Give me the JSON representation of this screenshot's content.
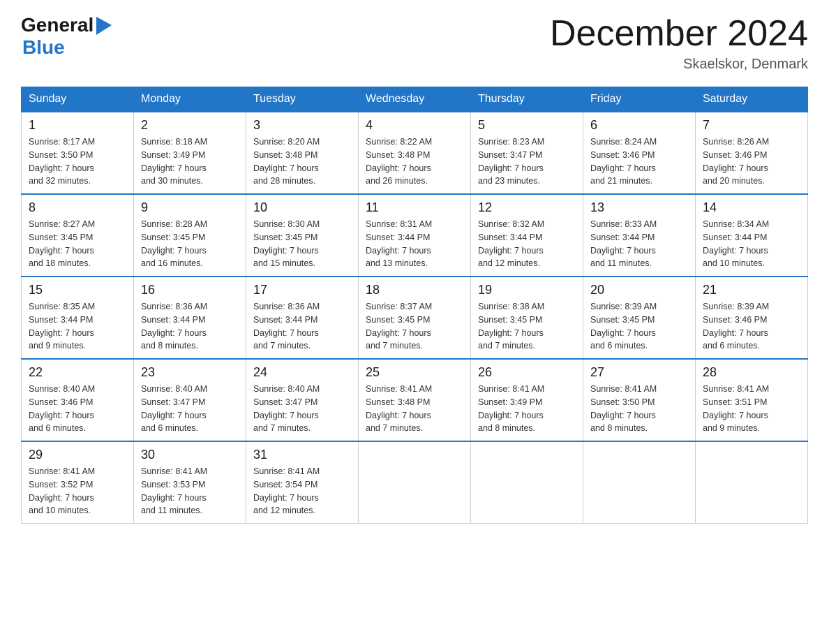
{
  "header": {
    "logo": {
      "general": "General",
      "blue": "Blue",
      "line2": "Blue"
    },
    "title": "December 2024",
    "location": "Skaelskor, Denmark"
  },
  "days_of_week": [
    "Sunday",
    "Monday",
    "Tuesday",
    "Wednesday",
    "Thursday",
    "Friday",
    "Saturday"
  ],
  "weeks": [
    [
      {
        "day": "1",
        "sunrise": "8:17 AM",
        "sunset": "3:50 PM",
        "daylight": "7 hours and 32 minutes."
      },
      {
        "day": "2",
        "sunrise": "8:18 AM",
        "sunset": "3:49 PM",
        "daylight": "7 hours and 30 minutes."
      },
      {
        "day": "3",
        "sunrise": "8:20 AM",
        "sunset": "3:48 PM",
        "daylight": "7 hours and 28 minutes."
      },
      {
        "day": "4",
        "sunrise": "8:22 AM",
        "sunset": "3:48 PM",
        "daylight": "7 hours and 26 minutes."
      },
      {
        "day": "5",
        "sunrise": "8:23 AM",
        "sunset": "3:47 PM",
        "daylight": "7 hours and 23 minutes."
      },
      {
        "day": "6",
        "sunrise": "8:24 AM",
        "sunset": "3:46 PM",
        "daylight": "7 hours and 21 minutes."
      },
      {
        "day": "7",
        "sunrise": "8:26 AM",
        "sunset": "3:46 PM",
        "daylight": "7 hours and 20 minutes."
      }
    ],
    [
      {
        "day": "8",
        "sunrise": "8:27 AM",
        "sunset": "3:45 PM",
        "daylight": "7 hours and 18 minutes."
      },
      {
        "day": "9",
        "sunrise": "8:28 AM",
        "sunset": "3:45 PM",
        "daylight": "7 hours and 16 minutes."
      },
      {
        "day": "10",
        "sunrise": "8:30 AM",
        "sunset": "3:45 PM",
        "daylight": "7 hours and 15 minutes."
      },
      {
        "day": "11",
        "sunrise": "8:31 AM",
        "sunset": "3:44 PM",
        "daylight": "7 hours and 13 minutes."
      },
      {
        "day": "12",
        "sunrise": "8:32 AM",
        "sunset": "3:44 PM",
        "daylight": "7 hours and 12 minutes."
      },
      {
        "day": "13",
        "sunrise": "8:33 AM",
        "sunset": "3:44 PM",
        "daylight": "7 hours and 11 minutes."
      },
      {
        "day": "14",
        "sunrise": "8:34 AM",
        "sunset": "3:44 PM",
        "daylight": "7 hours and 10 minutes."
      }
    ],
    [
      {
        "day": "15",
        "sunrise": "8:35 AM",
        "sunset": "3:44 PM",
        "daylight": "7 hours and 9 minutes."
      },
      {
        "day": "16",
        "sunrise": "8:36 AM",
        "sunset": "3:44 PM",
        "daylight": "7 hours and 8 minutes."
      },
      {
        "day": "17",
        "sunrise": "8:36 AM",
        "sunset": "3:44 PM",
        "daylight": "7 hours and 7 minutes."
      },
      {
        "day": "18",
        "sunrise": "8:37 AM",
        "sunset": "3:45 PM",
        "daylight": "7 hours and 7 minutes."
      },
      {
        "day": "19",
        "sunrise": "8:38 AM",
        "sunset": "3:45 PM",
        "daylight": "7 hours and 7 minutes."
      },
      {
        "day": "20",
        "sunrise": "8:39 AM",
        "sunset": "3:45 PM",
        "daylight": "7 hours and 6 minutes."
      },
      {
        "day": "21",
        "sunrise": "8:39 AM",
        "sunset": "3:46 PM",
        "daylight": "7 hours and 6 minutes."
      }
    ],
    [
      {
        "day": "22",
        "sunrise": "8:40 AM",
        "sunset": "3:46 PM",
        "daylight": "7 hours and 6 minutes."
      },
      {
        "day": "23",
        "sunrise": "8:40 AM",
        "sunset": "3:47 PM",
        "daylight": "7 hours and 6 minutes."
      },
      {
        "day": "24",
        "sunrise": "8:40 AM",
        "sunset": "3:47 PM",
        "daylight": "7 hours and 7 minutes."
      },
      {
        "day": "25",
        "sunrise": "8:41 AM",
        "sunset": "3:48 PM",
        "daylight": "7 hours and 7 minutes."
      },
      {
        "day": "26",
        "sunrise": "8:41 AM",
        "sunset": "3:49 PM",
        "daylight": "7 hours and 8 minutes."
      },
      {
        "day": "27",
        "sunrise": "8:41 AM",
        "sunset": "3:50 PM",
        "daylight": "7 hours and 8 minutes."
      },
      {
        "day": "28",
        "sunrise": "8:41 AM",
        "sunset": "3:51 PM",
        "daylight": "7 hours and 9 minutes."
      }
    ],
    [
      {
        "day": "29",
        "sunrise": "8:41 AM",
        "sunset": "3:52 PM",
        "daylight": "7 hours and 10 minutes."
      },
      {
        "day": "30",
        "sunrise": "8:41 AM",
        "sunset": "3:53 PM",
        "daylight": "7 hours and 11 minutes."
      },
      {
        "day": "31",
        "sunrise": "8:41 AM",
        "sunset": "3:54 PM",
        "daylight": "7 hours and 12 minutes."
      },
      null,
      null,
      null,
      null
    ]
  ],
  "labels": {
    "sunrise": "Sunrise:",
    "sunset": "Sunset:",
    "daylight": "Daylight:"
  }
}
